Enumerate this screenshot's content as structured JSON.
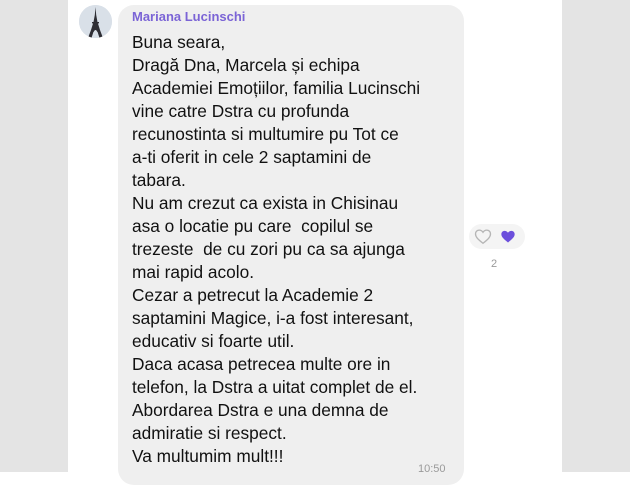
{
  "message": {
    "sender_name": "Mariana Lucinschi",
    "lines": [
      "Buna seara,",
      "Dragă Dna, Marcela și echipa",
      "Academiei Emoțiilor, familia Lucinschi",
      "vine catre Dstra cu profunda",
      "recunostinta si multumire pu Tot ce",
      "a-ti oferit in cele 2 saptamini de",
      "tabara.",
      "Nu am crezut ca exista in Chisinau",
      "asa o locatie pu care  copilul se",
      "trezeste  de cu zori pu ca sa ajunga",
      "mai rapid acolo.",
      "Cezar a petrecut la Academie 2",
      "saptamini Magice, i-a fost interesant,",
      "educativ si foarte util.",
      "Daca acasa petrecea multe ore in",
      "telefon, la Dstra a uitat complet de el.",
      "Abordarea Dstra e una demna de",
      "admiratie si respect.",
      "Va multumim mult!!!"
    ],
    "time": "10:50"
  },
  "reactions": {
    "count": "2",
    "icons": [
      "heart-outline-icon",
      "heart-filled-icon"
    ]
  },
  "colors": {
    "sender": "#7b64d6",
    "bubble": "#efefef",
    "heart_filled": "#6c4fdc",
    "side_panel": "#e4e4e4"
  },
  "avatar": {
    "icon": "eiffel-tower-avatar"
  }
}
